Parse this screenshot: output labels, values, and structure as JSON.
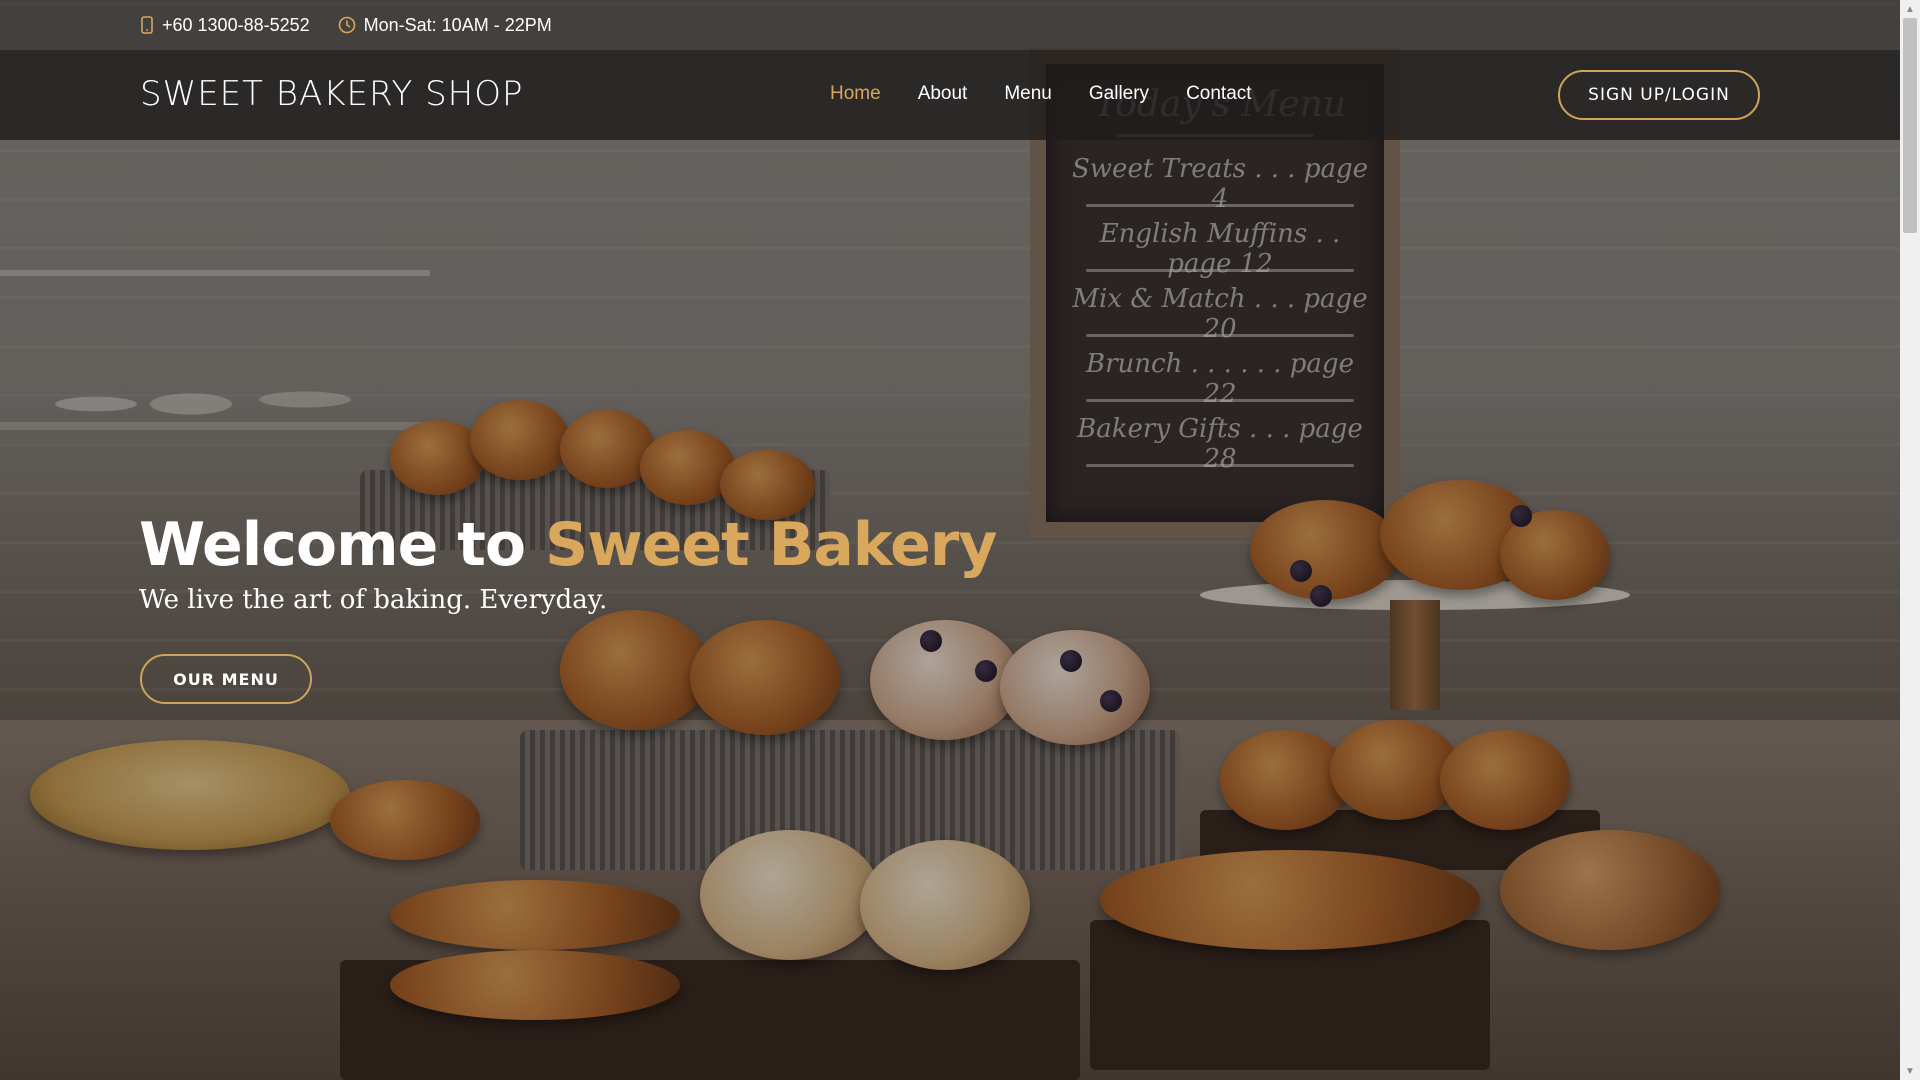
{
  "topbar": {
    "phone": "+60 1300-88-5252",
    "hours": "Mon-Sat: 10AM - 22PM"
  },
  "header": {
    "logo": "SWEET BAKERY SHOP",
    "nav": [
      {
        "label": "Home",
        "active": true
      },
      {
        "label": "About",
        "active": false
      },
      {
        "label": "Menu",
        "active": false
      },
      {
        "label": "Gallery",
        "active": false
      },
      {
        "label": "Contact",
        "active": false
      }
    ],
    "signup_label": "SIGN UP/LOGIN"
  },
  "hero": {
    "title_prefix": "Welcome to ",
    "title_accent": "Sweet Bakery",
    "subtitle": "We live the art of baking. Everyday.",
    "cta_label": "OUR MENU",
    "chalkboard": [
      "Today's Menu",
      "Sweet Treats . . . page 4",
      "English Muffins . . page 12",
      "Mix & Match . . . page 20",
      "Brunch . . . . . . page 22",
      "Bakery Gifts . . . page 28"
    ]
  },
  "colors": {
    "accent": "#d9a85d",
    "header_bg": "#1e1c1b",
    "button_border": "#cfa45a"
  },
  "icons": {
    "phone": "phone-icon",
    "clock": "clock-icon"
  }
}
